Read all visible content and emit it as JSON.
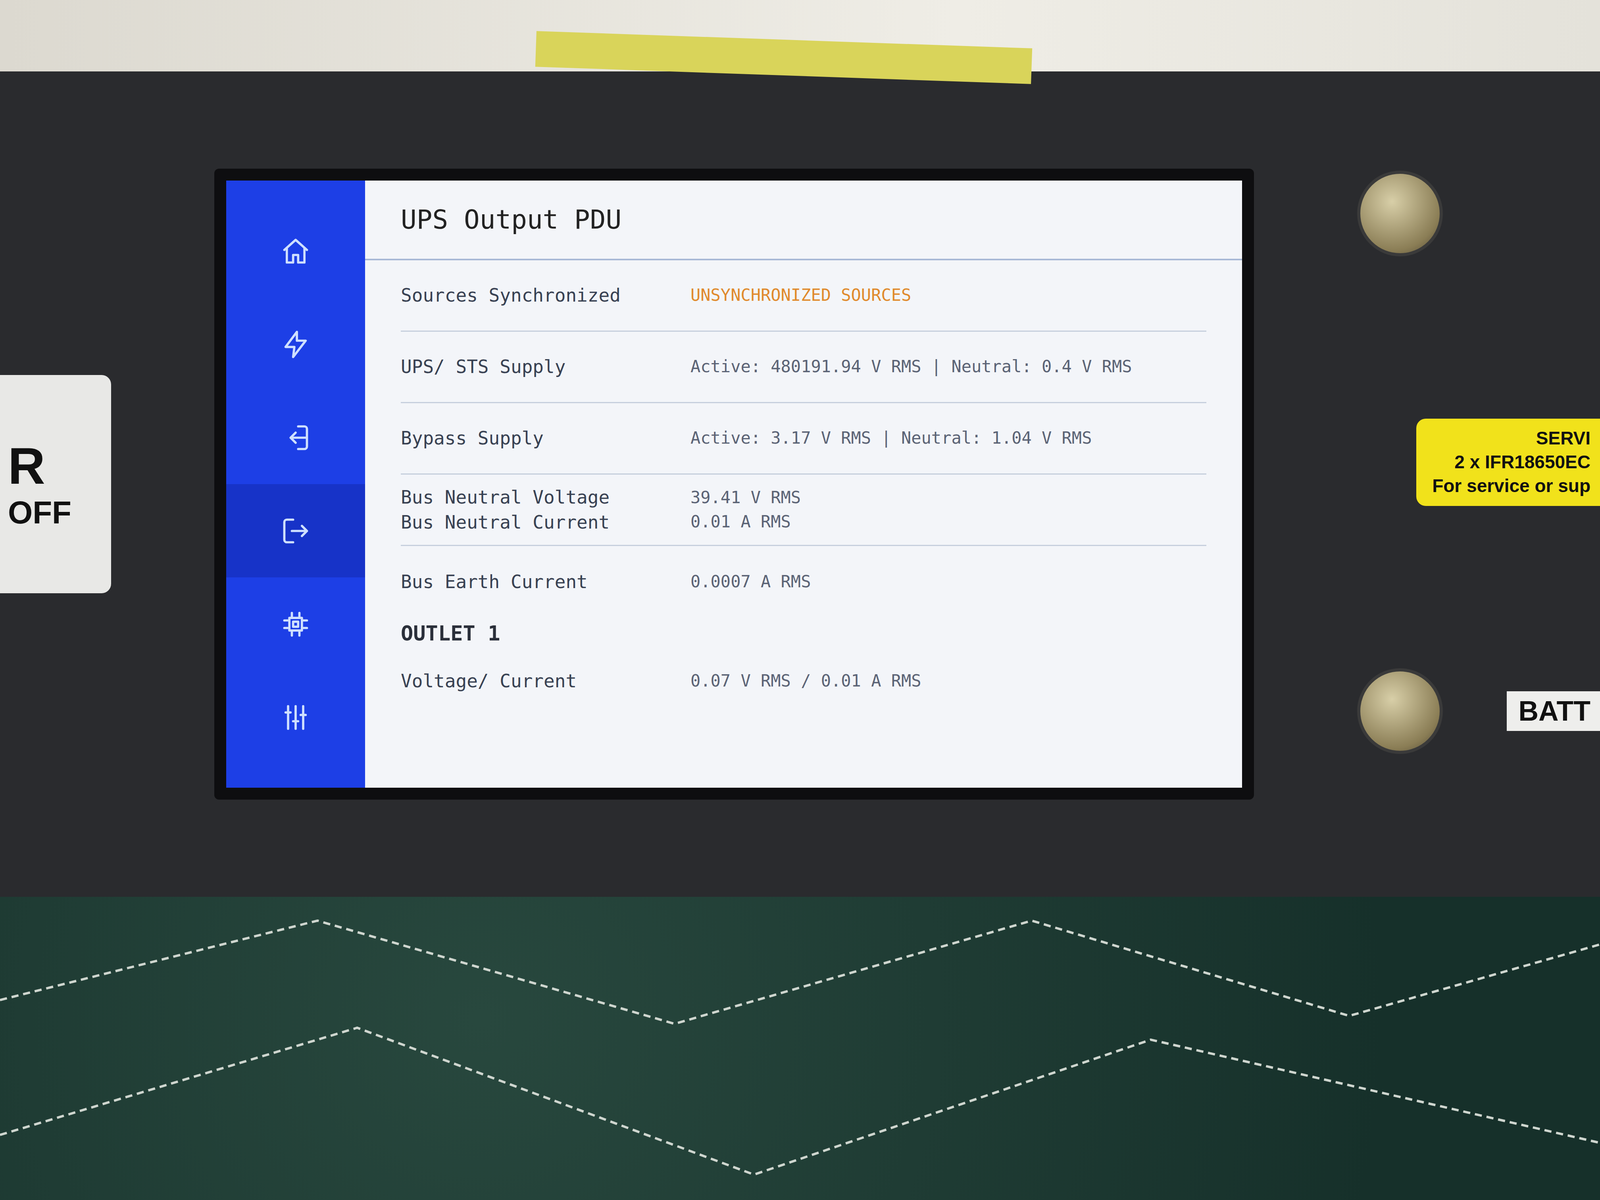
{
  "device": {
    "left_label": [
      "R",
      "OFF"
    ],
    "service_label": [
      "SERVI",
      "2 x IFR18650EC",
      "For service or sup"
    ],
    "battery_label": "BATT"
  },
  "sidebar": {
    "items": [
      {
        "selected": false
      },
      {
        "selected": false
      },
      {
        "selected": false
      },
      {
        "selected": true
      },
      {
        "selected": false
      },
      {
        "selected": false
      }
    ]
  },
  "title": "UPS Output PDU",
  "rows": [
    {
      "labels": [
        "Sources Synchronized"
      ],
      "values": [
        "UNSYNCHRONIZED SOURCES"
      ],
      "warning": true
    },
    {
      "labels": [
        "UPS/ STS Supply"
      ],
      "values": [
        "Active: 480191.94 V RMS | Neutral: 0.4 V RMS"
      ],
      "warning": false
    },
    {
      "labels": [
        "Bypass Supply"
      ],
      "values": [
        "Active: 3.17 V RMS | Neutral: 1.04 V RMS"
      ],
      "warning": false
    },
    {
      "labels": [
        "Bus Neutral Voltage",
        "Bus Neutral Current"
      ],
      "values": [
        "39.41 V RMS",
        "0.01 A RMS"
      ],
      "warning": false
    },
    {
      "labels": [
        "Bus Earth Current"
      ],
      "values": [
        "0.0007 A RMS"
      ],
      "warning": false
    }
  ],
  "outlets": [
    {
      "title": "OUTLET 1",
      "rows": [
        {
          "labels": [
            "Voltage/ Current"
          ],
          "values": [
            "0.07 V RMS / 0.01 A RMS"
          ],
          "warning": false
        }
      ]
    }
  ]
}
